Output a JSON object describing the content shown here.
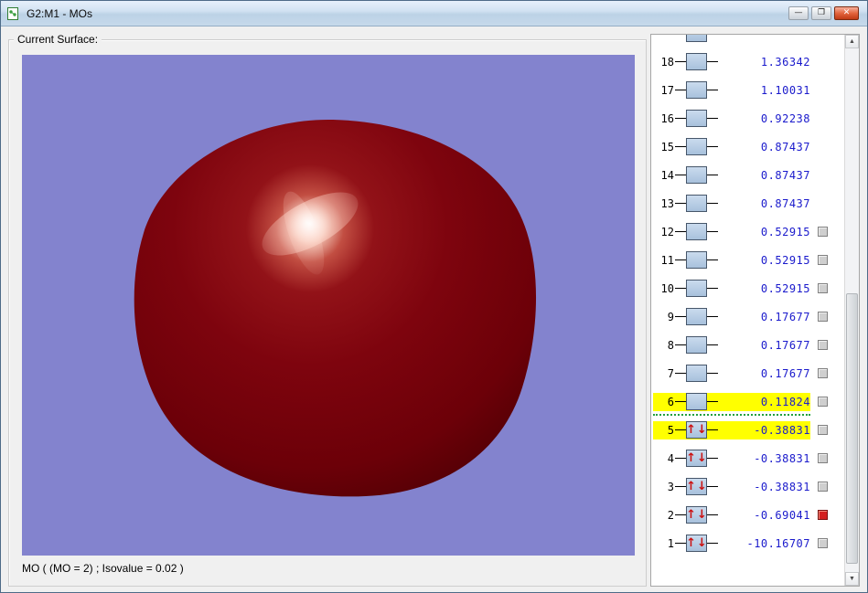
{
  "window": {
    "title": "G2:M1 - MOs",
    "controls": {
      "minimize": "—",
      "maximize": "❐",
      "close": "✕"
    }
  },
  "surface": {
    "group_label": "Current Surface:",
    "status_text": "MO ( (MO = 2) ; Isovalue = 0.02 )",
    "viewport_background": "#8383ce",
    "isosurface_colors": {
      "core": "#fdeee6",
      "mid": "#7e040e",
      "edge": "#4e0004"
    }
  },
  "mo_panel": {
    "arrow_up": "↑",
    "arrow_down": "↓",
    "energy_text_color": "#1a1acc",
    "highlight_color": "#ffff00",
    "gap_line_color": "#22a03e",
    "scrollbar": {
      "up_icon": "▲",
      "down_icon": "▼"
    },
    "rows": [
      {
        "level": "",
        "energy": "",
        "occupied": false,
        "selected": false,
        "checkbox": null,
        "partial": true
      },
      {
        "level": "18",
        "energy": "1.36342",
        "occupied": false,
        "selected": false,
        "checkbox": null
      },
      {
        "level": "17",
        "energy": "1.10031",
        "occupied": false,
        "selected": false,
        "checkbox": null
      },
      {
        "level": "16",
        "energy": "0.92238",
        "occupied": false,
        "selected": false,
        "checkbox": null
      },
      {
        "level": "15",
        "energy": "0.87437",
        "occupied": false,
        "selected": false,
        "checkbox": null
      },
      {
        "level": "14",
        "energy": "0.87437",
        "occupied": false,
        "selected": false,
        "checkbox": null
      },
      {
        "level": "13",
        "energy": "0.87437",
        "occupied": false,
        "selected": false,
        "checkbox": null
      },
      {
        "level": "12",
        "energy": "0.52915",
        "occupied": false,
        "selected": false,
        "checkbox": "gray"
      },
      {
        "level": "11",
        "energy": "0.52915",
        "occupied": false,
        "selected": false,
        "checkbox": "gray"
      },
      {
        "level": "10",
        "energy": "0.52915",
        "occupied": false,
        "selected": false,
        "checkbox": "gray"
      },
      {
        "level": "9",
        "energy": "0.17677",
        "occupied": false,
        "selected": false,
        "checkbox": "gray"
      },
      {
        "level": "8",
        "energy": "0.17677",
        "occupied": false,
        "selected": false,
        "checkbox": "gray"
      },
      {
        "level": "7",
        "energy": "0.17677",
        "occupied": false,
        "selected": false,
        "checkbox": "gray"
      },
      {
        "level": "6",
        "energy": "0.11824",
        "occupied": false,
        "selected": true,
        "checkbox": "gray"
      },
      {
        "level": "5",
        "energy": "-0.38831",
        "occupied": true,
        "selected": true,
        "checkbox": "gray",
        "gap_above": true
      },
      {
        "level": "4",
        "energy": "-0.38831",
        "occupied": true,
        "selected": false,
        "checkbox": "gray"
      },
      {
        "level": "3",
        "energy": "-0.38831",
        "occupied": true,
        "selected": false,
        "checkbox": "gray"
      },
      {
        "level": "2",
        "energy": "-0.69041",
        "occupied": true,
        "selected": false,
        "checkbox": "red"
      },
      {
        "level": "1",
        "energy": "-10.16707",
        "occupied": true,
        "selected": false,
        "checkbox": "gray"
      }
    ]
  }
}
